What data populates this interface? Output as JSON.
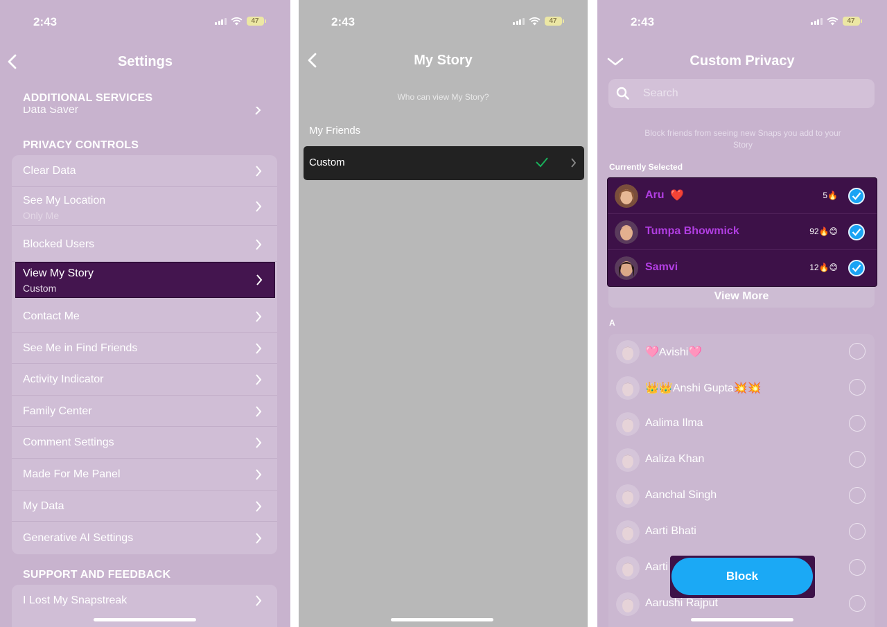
{
  "status_bar": {
    "time": "2:43",
    "battery": "47"
  },
  "panel1": {
    "title": "Settings",
    "section_additional": "ADDITIONAL SERVICES",
    "partial_item": "Data Saver",
    "section_privacy": "PRIVACY CONTROLS",
    "items": [
      {
        "label": "Clear Data"
      },
      {
        "label": "See My Location",
        "sub": "Only Me"
      },
      {
        "label": "Blocked Users"
      },
      {
        "label": "View My Story",
        "sub": "Custom",
        "selected": true
      },
      {
        "label": "Contact Me"
      },
      {
        "label": "See Me in Find Friends"
      },
      {
        "label": "Activity Indicator"
      },
      {
        "label": "Family Center"
      },
      {
        "label": "Comment Settings"
      },
      {
        "label": "Made For Me Panel"
      },
      {
        "label": "My Data"
      },
      {
        "label": "Generative AI Settings"
      }
    ],
    "section_support": "SUPPORT AND FEEDBACK",
    "support_items": [
      {
        "label": "I Lost My Snapstreak"
      }
    ]
  },
  "panel2": {
    "title": "My Story",
    "subtitle": "Who can view My Story?",
    "option_friends": "My Friends",
    "option_custom": "Custom"
  },
  "panel3": {
    "title": "Custom Privacy",
    "search_placeholder": "Search",
    "info": "Block friends from seeing new Snaps you add to your Story",
    "currently_selected": "Currently Selected",
    "selected": [
      {
        "name": "Aru",
        "emoji": "❤️",
        "streak": "5🔥"
      },
      {
        "name": "Tumpa Bhowmick",
        "emoji": "",
        "streak": "92🔥😊"
      },
      {
        "name": "Samvi",
        "emoji": "",
        "streak": "12🔥😊"
      }
    ],
    "view_more": "View More",
    "letter": "A",
    "friends": [
      {
        "name": "🩷Avishi🩷"
      },
      {
        "name": "👑👑Anshi Gupta💥💥"
      },
      {
        "name": "Aalima Ilma"
      },
      {
        "name": "Aaliza Khan"
      },
      {
        "name": "Aanchal Singh"
      },
      {
        "name": "Aarti Bhati"
      },
      {
        "name": "Aarti T"
      },
      {
        "name": "Aarushi Rajput"
      }
    ],
    "block_button": "Block"
  },
  "colors": {
    "panel_bg": "#c8b3ce",
    "selected_bg": "#44154f",
    "accent_blue": "#1ba9f5",
    "name_purple": "#b13ee2"
  }
}
